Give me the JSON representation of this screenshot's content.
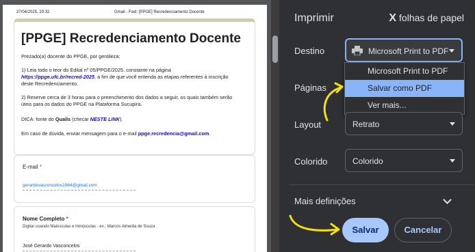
{
  "preview": {
    "header_date": "27/04/2025, 20:32",
    "header_title": "Gmail - Fwd: [PPGE] Recredenciamento Docente",
    "form_title": "[PPGE] Recredenciamento Docente",
    "intro": "Prezado(a) docente do PPGE, por gentileza:",
    "item1_line1": "1) Leia todo o teor do Edital nº 05/PPGE/2025, constante na página",
    "item1_link": "https://ppge.ufc.br/recred-2025",
    "item1_line2_rest": ", a fim de que você entenda as etapas referentes à inscrição",
    "item1_line3": "deste Recredenciamento.",
    "item2_line1": "2) Reserve cerca de 3 horas para o preenchimento dos dados a seguir, os quais também serão",
    "item2_line2": "úteis para os dados do PPGE na Plataforma Sucupira.",
    "dica_prefix": "DICA: fonte do",
    "dica_bold": "Qualis",
    "dica_mid": "(checar",
    "dica_link": "NESTE LINK",
    "dica_suffix": ").",
    "duvida_prefix": "Em caso de dúvida, enviar mensagem para o e-mail",
    "duvida_email": "ppge.recredencia@gmail.com",
    "duvida_suffix": ".",
    "email_label": "E-mail",
    "email_value": "gerardovasconcelos1964@gmail.com",
    "nome_label": "Nome Completo",
    "nome_help": "Digitar usando Maiúsculas e minúsculas - ex.: Marcos Almeida de Souza",
    "nome_value": "José Gerardo Vasconcelos",
    "required_mark": "*"
  },
  "panel": {
    "title": "Imprimir",
    "sheets_x": "X",
    "sheets_label": "folhas de papel",
    "destino_label": "Destino",
    "destino_value": "Microsoft Print to PDF",
    "dropdown_options": [
      "Microsoft Print to PDF",
      "Salvar como PDF",
      "Ver mais..."
    ],
    "paginas_label": "Páginas",
    "layout_label": "Layout",
    "layout_value": "Retrato",
    "colorido_label": "Colorido",
    "colorido_value": "Colorido",
    "more_settings": "Mais definições",
    "save_button": "Salvar",
    "cancel_button": "Cancelar"
  },
  "colors": {
    "accent": "#a8c7fa",
    "selected_option": "#8ab4f8",
    "annotation_arrow": "#f5e10a",
    "panel_bg": "#2f3033"
  }
}
